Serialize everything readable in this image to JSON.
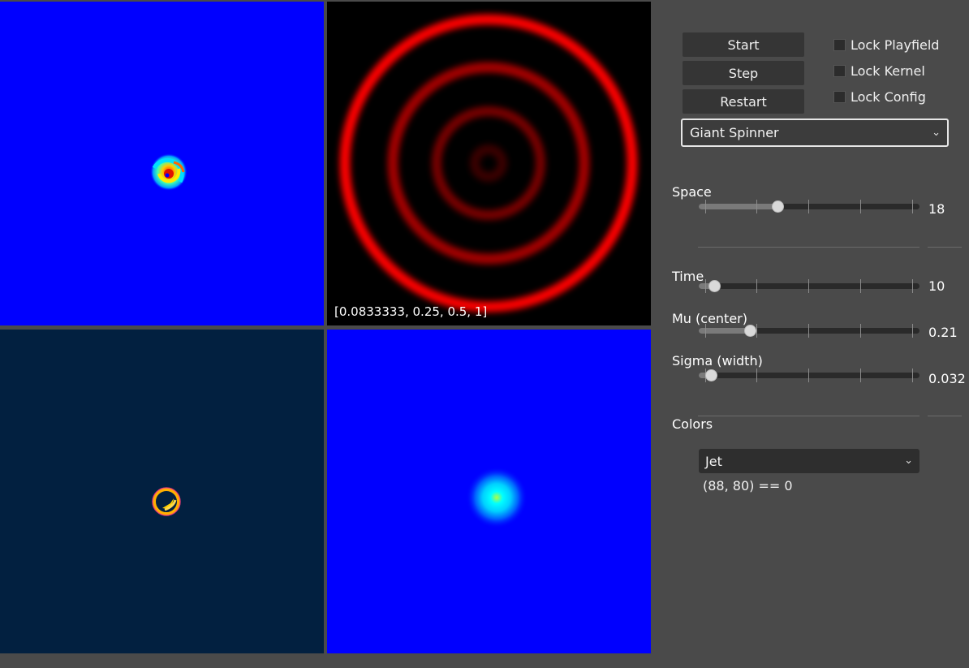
{
  "kernel": {
    "label": "[0.0833333, 0.25, 0.5, 1]"
  },
  "controls": {
    "start_label": "Start",
    "step_label": "Step",
    "restart_label": "Restart",
    "lock_playfield_label": "Lock Playfield",
    "lock_kernel_label": "Lock Kernel",
    "lock_config_label": "Lock Config",
    "lock_playfield_checked": false,
    "lock_kernel_checked": false,
    "lock_config_checked": false,
    "preset": "Giant Spinner"
  },
  "sliders": {
    "space": {
      "label": "Space",
      "value": "18",
      "fraction": 0.355
    },
    "time": {
      "label": "Time",
      "value": "10",
      "fraction": 0.07
    },
    "mu": {
      "label": "Mu (center)",
      "value": "0.21",
      "fraction": 0.23
    },
    "sigma": {
      "label": "Sigma (width)",
      "value": "0.032",
      "fraction": 0.055
    }
  },
  "colors": {
    "label": "Colors",
    "colormap": "Jet",
    "cell_readout": "(88, 80) == 0"
  },
  "palette": {
    "background": "#4a4a4a",
    "jet_blue": "#0000ff",
    "dark_navy": "#022040",
    "kernel_red": "#ff0000",
    "button": "#353535"
  }
}
